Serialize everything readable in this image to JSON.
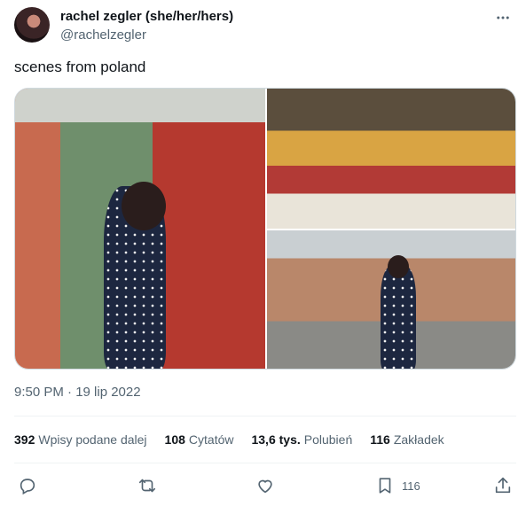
{
  "author": {
    "name": "rachel zegler (she/her/hers)",
    "handle": "@rachelzegler"
  },
  "tweet": {
    "text": "scenes from poland",
    "timestamp": "9:50 PM · 19 lip 2022"
  },
  "stats": {
    "retweets_value": "392",
    "retweets_label": "Wpisy podane dalej",
    "quotes_value": "108",
    "quotes_label": "Cytatów",
    "likes_value": "13,6 tys.",
    "likes_label": "Polubień",
    "bookmarks_value": "116",
    "bookmarks_label": "Zakładek"
  },
  "actions": {
    "bookmark_count": "116"
  },
  "icons": {
    "more": "more-horizontal-icon",
    "reply": "reply-icon",
    "retweet": "retweet-icon",
    "like": "heart-icon",
    "bookmark": "bookmark-icon",
    "share": "share-icon"
  }
}
